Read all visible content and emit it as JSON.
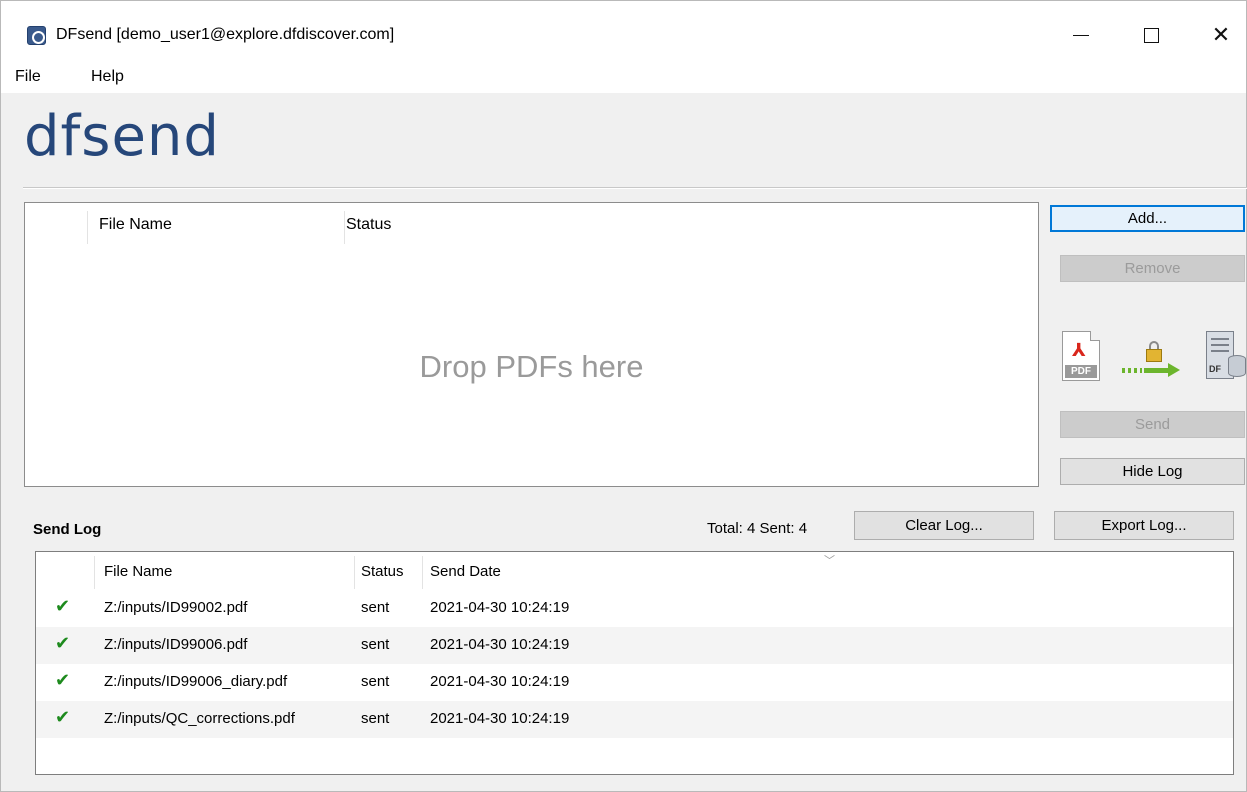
{
  "window": {
    "title": "DFsend [demo_user1@explore.dfdiscover.com]",
    "controls": {
      "minimize": "minimize",
      "maximize": "maximize",
      "close": "✕"
    }
  },
  "menu": {
    "file": "File",
    "help": "Help"
  },
  "brand": {
    "logo_text": "dfsend",
    "color": "#26477a"
  },
  "file_table": {
    "columns": {
      "file_name": "File Name",
      "status": "Status"
    },
    "drop_hint": "Drop PDFs here"
  },
  "actions": {
    "add": "Add...",
    "remove": "Remove",
    "send": "Send",
    "hide_log": "Hide Log",
    "flow_icons": [
      "pdf-icon",
      "lock-arrow-icon",
      "database-icon"
    ],
    "flow_labels": {
      "pdf": "PDF",
      "db": "DF"
    }
  },
  "send_log": {
    "title": "Send Log",
    "totals": "Total: 4  Sent: 4",
    "clear_button": "Clear Log...",
    "export_button": "Export Log...",
    "columns": {
      "file_name": "File Name",
      "status": "Status",
      "send_date": "Send Date"
    },
    "rows": [
      {
        "file_name": "Z:/inputs/ID99002.pdf",
        "status": "sent",
        "send_date": "2021-04-30 10:24:19",
        "check": "✔"
      },
      {
        "file_name": "Z:/inputs/ID99006.pdf",
        "status": "sent",
        "send_date": "2021-04-30 10:24:19",
        "check": "✔"
      },
      {
        "file_name": "Z:/inputs/ID99006_diary.pdf",
        "status": "sent",
        "send_date": "2021-04-30 10:24:19",
        "check": "✔"
      },
      {
        "file_name": "Z:/inputs/QC_corrections.pdf",
        "status": "sent",
        "send_date": "2021-04-30 10:24:19",
        "check": "✔"
      }
    ]
  },
  "colors": {
    "accent": "#0078d7",
    "success": "#1d8a1d",
    "disabled_text": "#9b9b9b"
  }
}
